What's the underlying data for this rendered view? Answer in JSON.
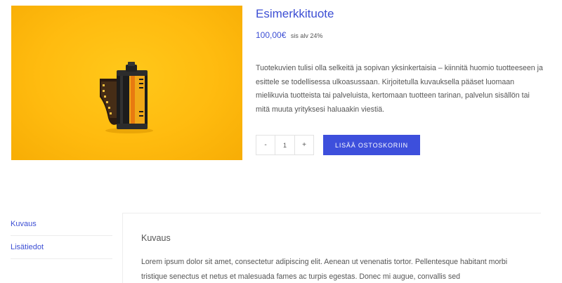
{
  "product": {
    "image_alt": "film-canister-photo",
    "title": "Esimerkkituote",
    "price": "100,00€",
    "tax_note": "sis alv 24%",
    "description": "Tuotekuvien tulisi olla selkeitä ja sopivan yksinkertaisia – kiinnitä huomio tuotteeseen ja esittele se todellisessa ulkoasussaan. Kirjoitetulla kuvauksella pääset luomaan mielikuvia tuotteista tai palveluista, kertomaan tuotteen tarinan, palvelun sisällön tai mitä muuta yrityksesi haluaakin viestiä."
  },
  "cart": {
    "minus_label": "-",
    "quantity": "1",
    "plus_label": "+",
    "add_button": "LISÄÄ OSTOSKORIIN"
  },
  "tabs": [
    {
      "label": "Kuvaus"
    },
    {
      "label": "Lisätiedot"
    }
  ],
  "panel": {
    "title": "Kuvaus",
    "text": "Lorem ipsum dolor sit amet, consectetur adipiscing elit. Aenean ut venenatis tortor. Pellentesque habitant morbi tristique senectus et netus et malesuada fames ac turpis egestas. Donec mi augue, convallis sed"
  },
  "colors": {
    "accent": "#3d4fdc",
    "image_background": "#ffbb0f"
  }
}
